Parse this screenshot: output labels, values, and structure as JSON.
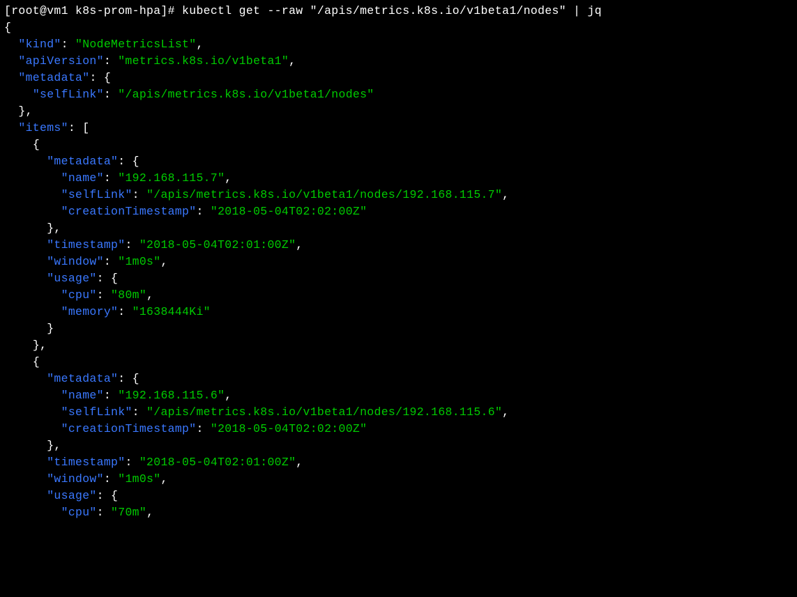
{
  "prompt": {
    "user_host": "[root@vm1 k8s-prom-hpa]#",
    "command": " kubectl get --raw \"/apis/metrics.k8s.io/v1beta1/nodes\" | jq"
  },
  "json": {
    "kind_key": "\"kind\"",
    "kind_val": "\"NodeMetricsList\"",
    "apiVersion_key": "\"apiVersion\"",
    "apiVersion_val": "\"metrics.k8s.io/v1beta1\"",
    "metadata_key": "\"metadata\"",
    "selfLink_key": "\"selfLink\"",
    "selfLink_val": "\"/apis/metrics.k8s.io/v1beta1/nodes\"",
    "items_key": "\"items\"",
    "item0": {
      "metadata_key": "\"metadata\"",
      "name_key": "\"name\"",
      "name_val": "\"192.168.115.7\"",
      "selfLink_key": "\"selfLink\"",
      "selfLink_val": "\"/apis/metrics.k8s.io/v1beta1/nodes/192.168.115.7\"",
      "creation_key": "\"creationTimestamp\"",
      "creation_val": "\"2018-05-04T02:02:00Z\"",
      "timestamp_key": "\"timestamp\"",
      "timestamp_val": "\"2018-05-04T02:01:00Z\"",
      "window_key": "\"window\"",
      "window_val": "\"1m0s\"",
      "usage_key": "\"usage\"",
      "cpu_key": "\"cpu\"",
      "cpu_val": "\"80m\"",
      "memory_key": "\"memory\"",
      "memory_val": "\"1638444Ki\""
    },
    "item1": {
      "metadata_key": "\"metadata\"",
      "name_key": "\"name\"",
      "name_val": "\"192.168.115.6\"",
      "selfLink_key": "\"selfLink\"",
      "selfLink_val": "\"/apis/metrics.k8s.io/v1beta1/nodes/192.168.115.6\"",
      "creation_key": "\"creationTimestamp\"",
      "creation_val": "\"2018-05-04T02:02:00Z\"",
      "timestamp_key": "\"timestamp\"",
      "timestamp_val": "\"2018-05-04T02:01:00Z\"",
      "window_key": "\"window\"",
      "window_val": "\"1m0s\"",
      "usage_key": "\"usage\"",
      "cpu_key": "\"cpu\"",
      "cpu_val": "\"70m\""
    }
  }
}
